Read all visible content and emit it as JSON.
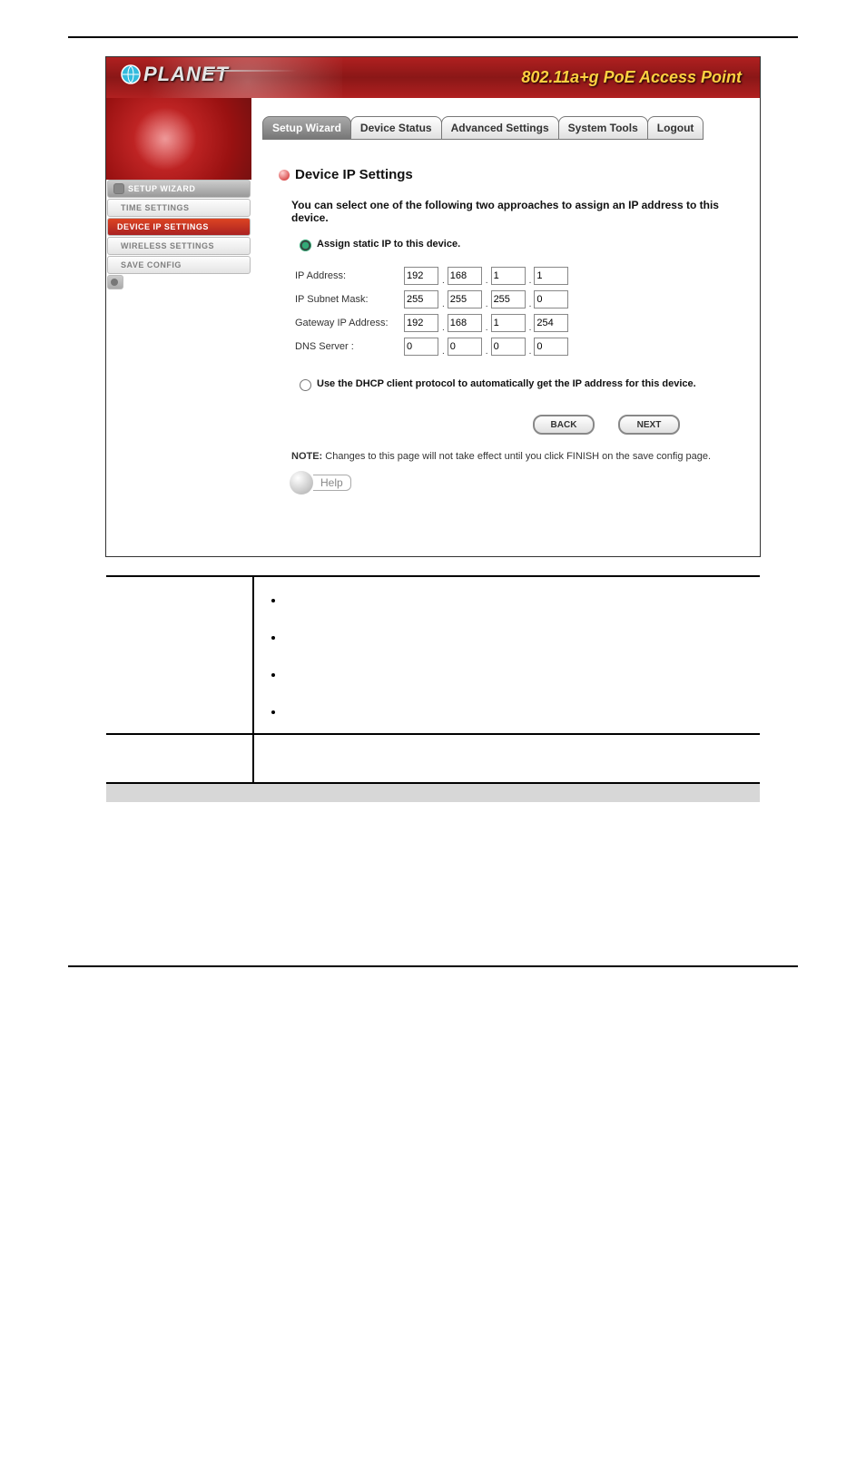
{
  "banner": {
    "logo_text": "PLANET",
    "title": "802.11a+g PoE Access Point"
  },
  "tabs": [
    {
      "label": "Setup Wizard",
      "active": true
    },
    {
      "label": "Device Status",
      "active": false
    },
    {
      "label": "Advanced Settings",
      "active": false
    },
    {
      "label": "System Tools",
      "active": false
    },
    {
      "label": "Logout",
      "active": false
    }
  ],
  "sidebar": {
    "items": [
      {
        "label": "Setup Wizard",
        "kind": "parent"
      },
      {
        "label": "Time Settings",
        "kind": "normal"
      },
      {
        "label": "Device IP Settings",
        "kind": "active"
      },
      {
        "label": "Wireless Settings",
        "kind": "normal"
      },
      {
        "label": "Save Config",
        "kind": "normal"
      }
    ]
  },
  "section": {
    "title": "Device IP Settings",
    "intro": "You can select one of the following two approaches to assign an IP address to this device.",
    "radio_static": "Assign static IP to this device.",
    "radio_dhcp": "Use the DHCP client protocol to automatically get the IP address for this device."
  },
  "fields": {
    "ip_label": "IP Address:",
    "ip": [
      "192",
      "168",
      "1",
      "1"
    ],
    "mask_label": "IP Subnet Mask:",
    "mask": [
      "255",
      "255",
      "255",
      "0"
    ],
    "gw_label": "Gateway IP Address:",
    "gw": [
      "192",
      "168",
      "1",
      "254"
    ],
    "dns_label": "DNS Server :",
    "dns": [
      "0",
      "0",
      "0",
      "0"
    ]
  },
  "buttons": {
    "back": "BACK",
    "next": "NEXT"
  },
  "note": {
    "prefix": "NOTE:",
    "text": " Changes to this page will not take effect until you click FINISH on the save config page."
  },
  "help_label": "Help",
  "opts_table": {
    "row1_bullets": [
      "",
      "",
      "",
      ""
    ],
    "row2_text": ""
  }
}
